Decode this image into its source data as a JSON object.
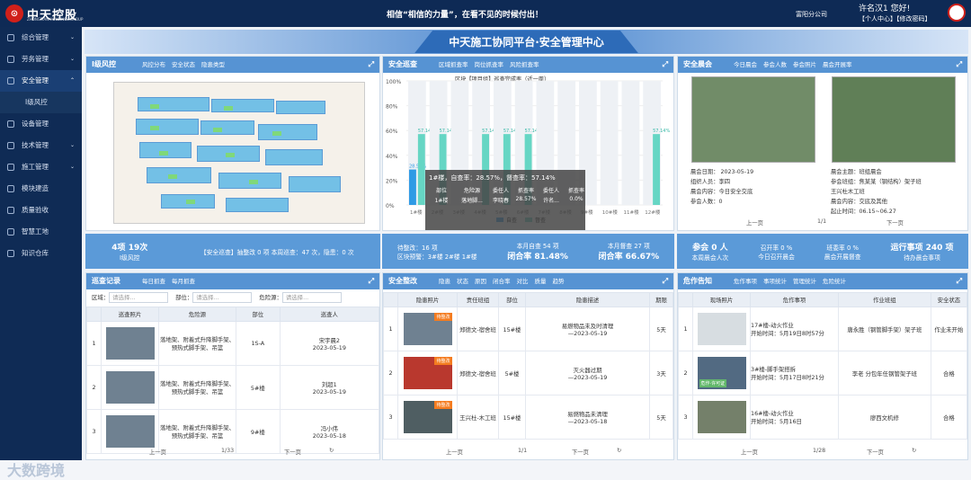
{
  "brand": {
    "logo_text": "中天控股",
    "logo_sub": "ZHONGTIAN HOLDINGS GROUP"
  },
  "header": {
    "slogan": "相信“相信的力量”，在看不见的时候付出！",
    "company": "富阳分公司",
    "user_line1": "许名汉1 您好!",
    "user_line2": "【个人中心】【修改密码】"
  },
  "sidebar": {
    "items": [
      {
        "label": "综合管理"
      },
      {
        "label": "劳务管理"
      },
      {
        "label": "安全管理"
      },
      {
        "label": "I级风控"
      },
      {
        "label": "设备管理"
      },
      {
        "label": "技术管理"
      },
      {
        "label": "施工管理"
      },
      {
        "label": "模块建造"
      },
      {
        "label": "质量验收"
      },
      {
        "label": "智慧工地"
      },
      {
        "label": "知识仓库"
      }
    ]
  },
  "watermark": "大数跨境",
  "page_title": "中天施工协同平台·安全管理中心",
  "risk": {
    "title": "I级风控",
    "tabs": [
      "风控分布",
      "安全状态",
      "隐患类型"
    ],
    "stat_a": "4项 19次",
    "stat_b": "I级风控",
    "stat_c": "【安全巡查】抽整改 0 项   本周巡查：47 次，隐患：0 次"
  },
  "patrol": {
    "title": "安全巡查",
    "tabs": [
      "区域抓查率",
      "岗位抓查率",
      "风险抓查率"
    ],
    "chart_title": "区块【项目组】巡查完成率（近一周）",
    "legend": [
      "自查",
      "督查"
    ],
    "tooltip": {
      "head": "1#楼，自查率：28.57%，督查率：57.14%",
      "cols": [
        "部位",
        "危险源",
        "委任人",
        "抓查率",
        "委任人",
        "抓查率"
      ],
      "row": [
        "1#楼",
        "落地脚...",
        "李晓春",
        "28.57%",
        "许名...",
        "0.0%"
      ]
    },
    "stat_a": "待整改：16 项",
    "stat_b": "区块预警：3#楼 2#楼 1#楼",
    "stat_c": "本月自查 54 项",
    "stat_d": "闭合率 81.48%",
    "stat_e": "本月督查 27 项",
    "stat_f": "闭合率 66.67%"
  },
  "chart_data": {
    "type": "bar",
    "categories": [
      "1#楼",
      "2#楼",
      "3#楼",
      "4#楼",
      "5#楼",
      "6#楼",
      "7#楼",
      "8#楼",
      "9#楼",
      "10#楼",
      "11#楼",
      "12#楼"
    ],
    "series": [
      {
        "name": "自查",
        "values": [
          28.57,
          0,
          0,
          0,
          0,
          0,
          0,
          0,
          0,
          0,
          0,
          0
        ]
      },
      {
        "name": "督查",
        "values": [
          57.14,
          57.14,
          0,
          57.14,
          57.14,
          57.14,
          0,
          0,
          0,
          0,
          0,
          57.14
        ]
      }
    ],
    "ylim": [
      0,
      100
    ],
    "yticks": [
      "100%",
      "80%",
      "60%",
      "40%",
      "20%",
      "0%"
    ]
  },
  "meeting": {
    "title": "安全晨会",
    "tabs": [
      "今日晨会",
      "参会人数",
      "参会照片",
      "晨会开展率"
    ],
    "left": {
      "date": "晨会日期： 2023-05-19",
      "host": "组织人员：李四",
      "status": "晨会内容：今日安全交底",
      "people": "参会人数：0"
    },
    "right": {
      "type": "晨会主题：班组晨会",
      "host": "参会班组：焦某某（钢结构）架子班",
      "worker": "王兴杜木工班",
      "content": "晨会内容：交底及其他",
      "range": "起止时间：06.15~06.27"
    },
    "pager": {
      "prev": "上一页",
      "page": "1/1",
      "next": "下一页"
    },
    "stats": [
      "参会 0 人",
      "召开率 0 %",
      "班委率 0 %",
      "运行事项 240 项"
    ],
    "stats2": [
      "本周晨会人次",
      "今日召开晨会",
      "晨会开展督查",
      "待办晨会事项"
    ]
  },
  "records": {
    "title": "巡查记录",
    "tabs": [
      "每日抓查",
      "每月抓查"
    ],
    "filters": [
      "区域：",
      "请选择...",
      "部位：",
      "请选择...",
      "危险源：",
      "请选择..."
    ],
    "columns": [
      "巡查照片",
      "危险源",
      "部位",
      "巡查人"
    ],
    "rows": [
      {
        "idx": "1",
        "hazard": "落地架、附着式升降脚手架、预热式脚手架、吊篮",
        "part": "1S-A",
        "person": "宋宇晨2",
        "time": "2023-05-19"
      },
      {
        "idx": "2",
        "hazard": "落地架、附着式升降脚手架、预热式脚手架、吊篮",
        "part": "5#楼",
        "person": "刘超1",
        "time": "2023-05-19"
      },
      {
        "idx": "3",
        "hazard": "落地架、附着式升降脚手架、预热式脚手架、吊篮",
        "part": "9#楼",
        "person": "冯小伟",
        "time": "2023-05-18"
      }
    ],
    "pager": {
      "prev": "上一页",
      "page": "1/33",
      "next": "下一页"
    }
  },
  "rectify": {
    "title": "安全整改",
    "tabs": [
      "隐患",
      "状态",
      "原因",
      "闭合率",
      "对比",
      "质量",
      "趋势"
    ],
    "columns": [
      "隐患照片",
      "责任班组",
      "部位",
      "隐患描述",
      "期限"
    ],
    "rows": [
      {
        "idx": "1",
        "team": "郑德文-宿舍班",
        "part": "15#楼",
        "desc": "易燃物品未及时清理",
        "date": "—2023-05-19",
        "limit": "5天"
      },
      {
        "idx": "2",
        "team": "郑德文-宿舍班",
        "part": "5#楼",
        "desc": "灭火器过期",
        "date": "—2023-05-19",
        "limit": "3天"
      },
      {
        "idx": "3",
        "team": "王兴杜-木工班",
        "part": "15#楼",
        "desc": "易燃物品未清理",
        "date": "—2023-05-18",
        "limit": "5天"
      }
    ],
    "badge": "待整改",
    "pager": {
      "prev": "上一页",
      "page": "1/1",
      "next": "下一页"
    }
  },
  "danger": {
    "title": "危作告知",
    "tabs": [
      "危作事项",
      "事项统计",
      "管理统计",
      "危险统计"
    ],
    "columns": [
      "现场照片",
      "危作事项",
      "作业班组",
      "安全状态"
    ],
    "rows": [
      {
        "idx": "1",
        "item": "17#楼-动火作业",
        "time": "开始时间：5月19日8时57分",
        "team": "唐永胜（钢管脚手架）架子班",
        "state": "作业未开始"
      },
      {
        "idx": "2",
        "item": "3#楼-脚手架搭拆",
        "time": "开始时间：5月17日8时21分",
        "team": "李老 分包年任钢管架子班",
        "state": "合格"
      },
      {
        "idx": "3",
        "item": "16#楼-动火作业",
        "time": "开始时间：5月16日",
        "team": "廖西文机修",
        "state": "合格"
      }
    ],
    "photo_tag": "危作·许可证",
    "pager": {
      "prev": "上一页",
      "page": "1/28",
      "next": "下一页"
    }
  }
}
